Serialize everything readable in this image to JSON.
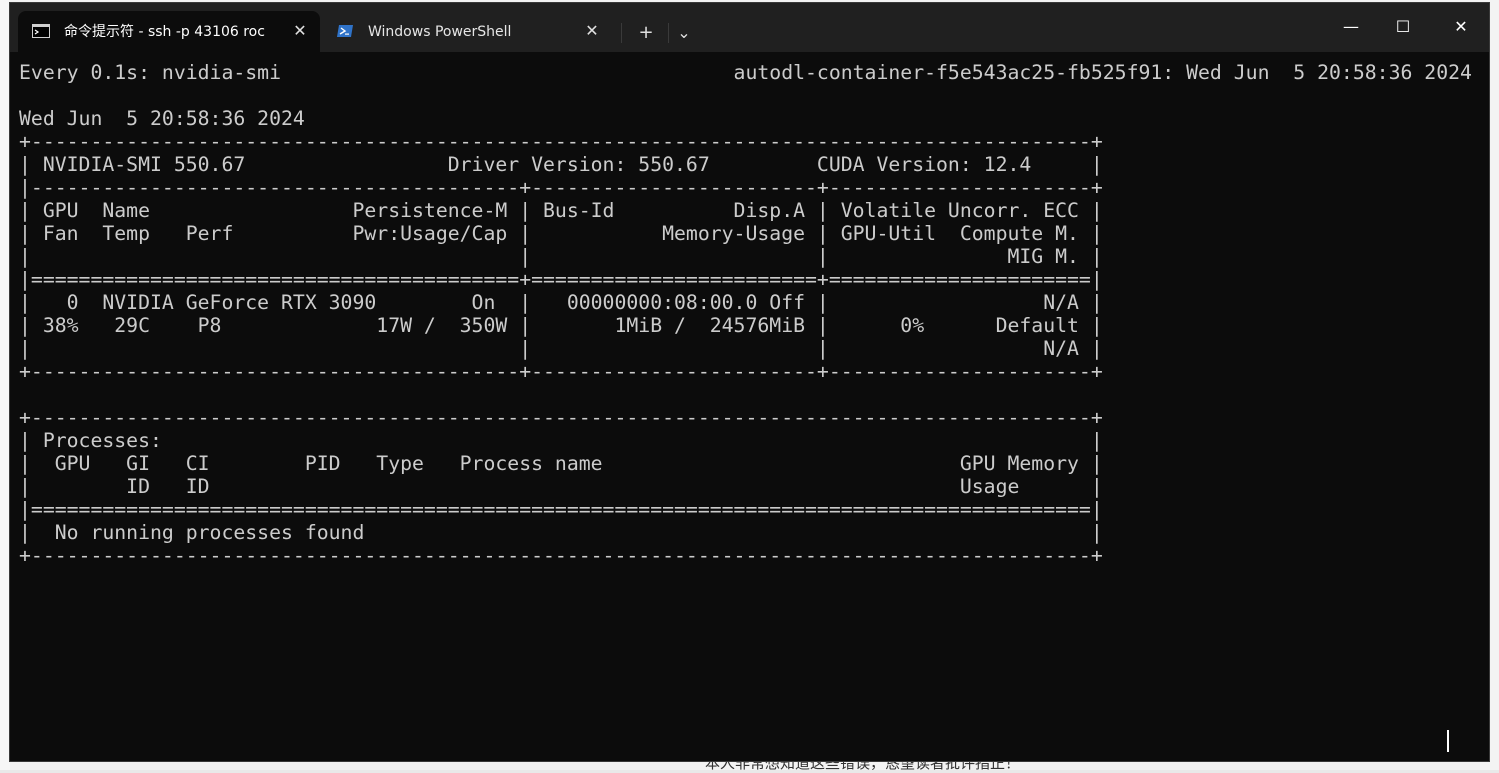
{
  "window": {
    "tabs": [
      {
        "label": "命令提示符 - ssh  -p 43106 roc",
        "close": "✕"
      },
      {
        "label": "Windows PowerShell",
        "close": "✕"
      }
    ],
    "new_tab": "+",
    "dropdown": "⌄",
    "minimize": "—",
    "maximize": "☐",
    "close": "✕"
  },
  "background": {
    "bottom_text": "本人非常想知道这些错误，恳望读者批评指正！"
  },
  "terminal": {
    "lines": [
      "Every 0.1s: nvidia-smi                                      autodl-container-f5e543ac25-fb525f91: Wed Jun  5 20:58:36 2024",
      "",
      "Wed Jun  5 20:58:36 2024",
      "+-----------------------------------------------------------------------------------------+",
      "| NVIDIA-SMI 550.67                 Driver Version: 550.67         CUDA Version: 12.4     |",
      "|-----------------------------------------+------------------------+----------------------+",
      "| GPU  Name                 Persistence-M | Bus-Id          Disp.A | Volatile Uncorr. ECC |",
      "| Fan  Temp   Perf          Pwr:Usage/Cap |           Memory-Usage | GPU-Util  Compute M. |",
      "|                                         |                        |               MIG M. |",
      "|=========================================+========================+======================|",
      "|   0  NVIDIA GeForce RTX 3090        On  |   00000000:08:00.0 Off |                  N/A |",
      "| 38%   29C    P8             17W /  350W |       1MiB /  24576MiB |      0%      Default |",
      "|                                         |                        |                  N/A |",
      "+-----------------------------------------+------------------------+----------------------+",
      "",
      "+-----------------------------------------------------------------------------------------+",
      "| Processes:                                                                              |",
      "|  GPU   GI   CI        PID   Type   Process name                              GPU Memory |",
      "|        ID   ID                                                               Usage      |",
      "|=========================================================================================|",
      "|  No running processes found                                                             |",
      "+-----------------------------------------------------------------------------------------+"
    ]
  },
  "colors": {
    "terminal_bg": "#0c0c0c",
    "terminal_fg": "#cccccc",
    "titlebar_bg": "#202020",
    "powershell_icon": "#2f73c9"
  }
}
